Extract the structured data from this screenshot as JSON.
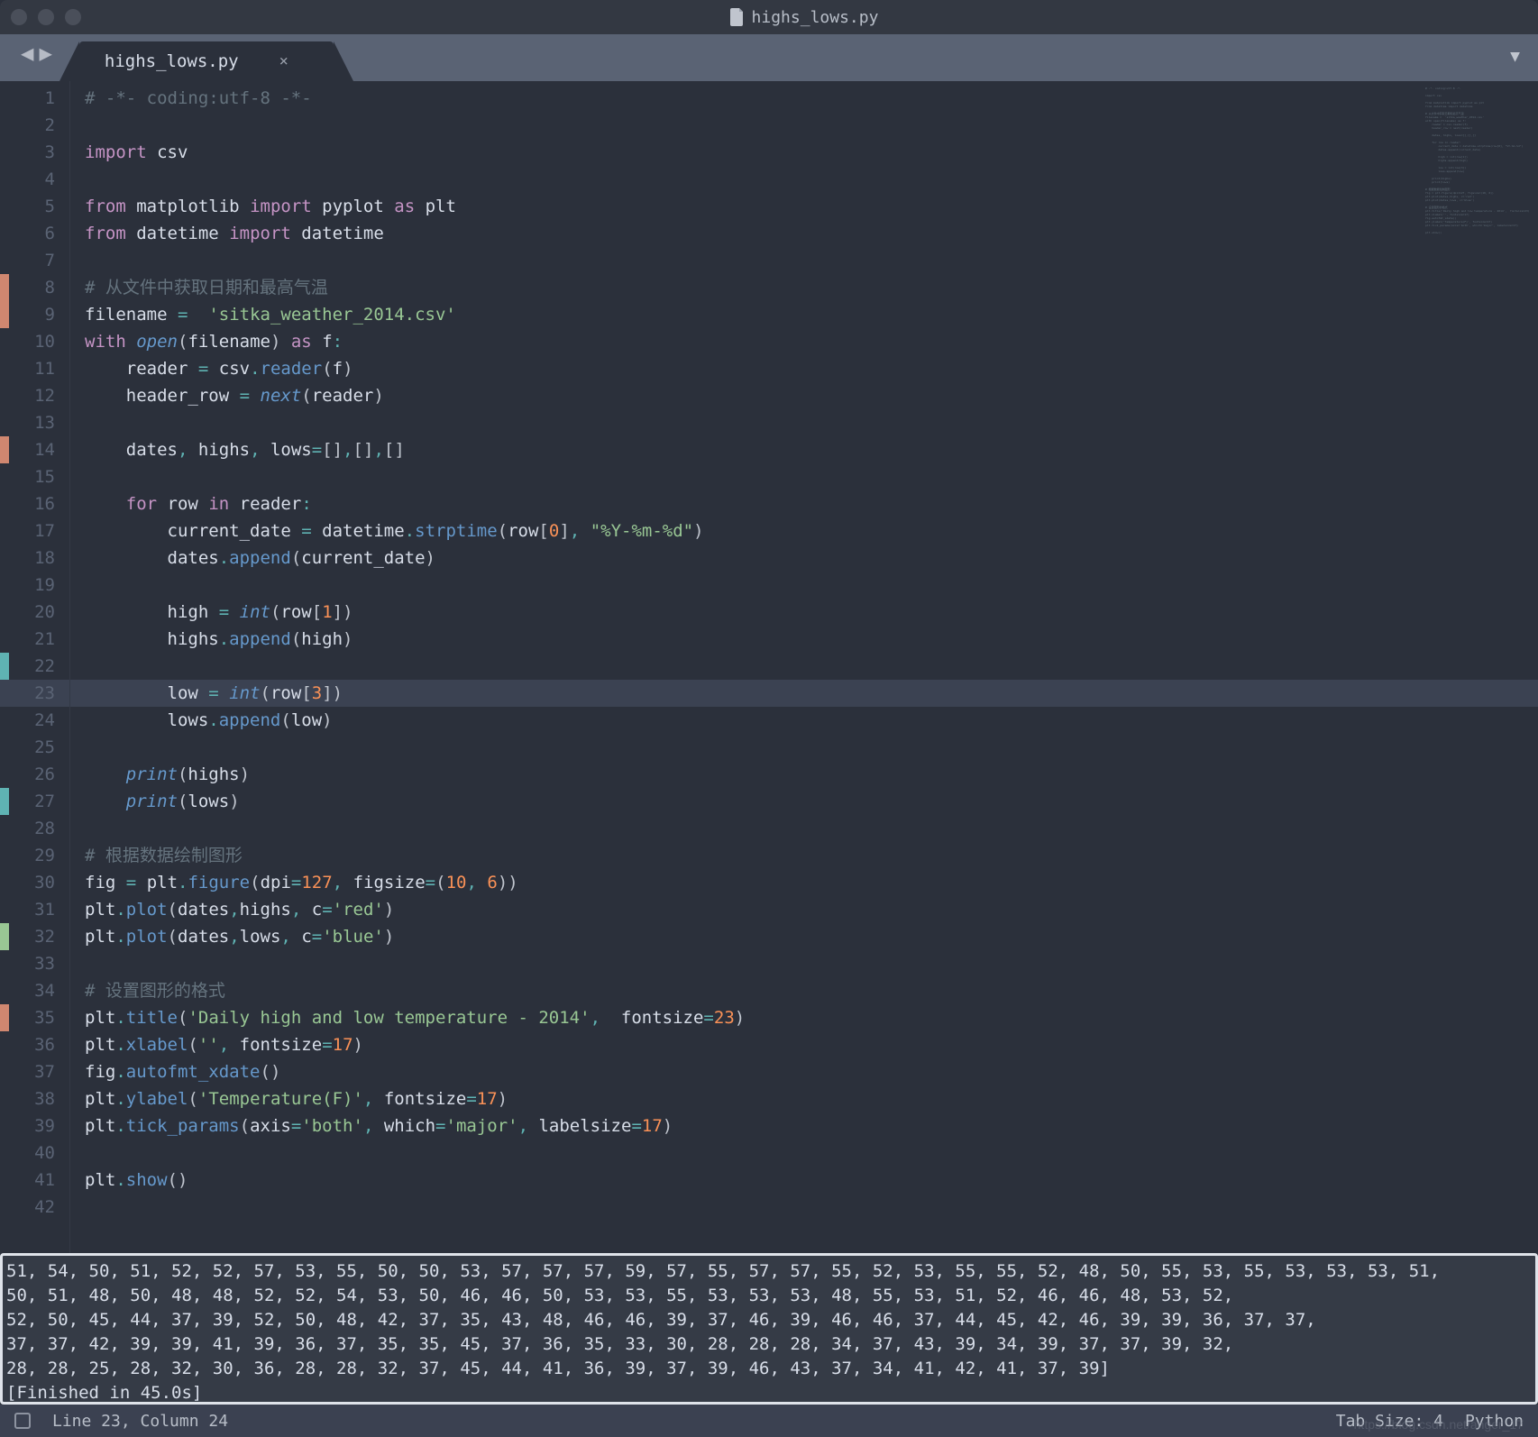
{
  "window": {
    "title": "highs_lows.py"
  },
  "tabs": [
    {
      "label": "highs_lows.py",
      "close": "×"
    }
  ],
  "nav": {
    "back": "◀",
    "forward": "▶",
    "dropdown": "▼"
  },
  "gutter_markers": {
    "orange": [
      8,
      9,
      14,
      35
    ],
    "teal": [
      22,
      27
    ],
    "green": [
      32
    ]
  },
  "highlighted_line": 23,
  "code_lines": [
    {
      "n": 1,
      "seg": [
        {
          "c": "cmt",
          "t": "# -*- coding:utf-8 -*-"
        }
      ]
    },
    {
      "n": 2,
      "seg": []
    },
    {
      "n": 3,
      "seg": [
        {
          "c": "kw",
          "t": "import"
        },
        {
          "c": "pn",
          "t": " "
        },
        {
          "c": "nm",
          "t": "csv"
        }
      ]
    },
    {
      "n": 4,
      "seg": []
    },
    {
      "n": 5,
      "seg": [
        {
          "c": "kw",
          "t": "from"
        },
        {
          "c": "pn",
          "t": " "
        },
        {
          "c": "nm",
          "t": "matplotlib"
        },
        {
          "c": "pn",
          "t": " "
        },
        {
          "c": "kw",
          "t": "import"
        },
        {
          "c": "pn",
          "t": " "
        },
        {
          "c": "nm",
          "t": "pyplot"
        },
        {
          "c": "pn",
          "t": " "
        },
        {
          "c": "kw",
          "t": "as"
        },
        {
          "c": "pn",
          "t": " "
        },
        {
          "c": "nm",
          "t": "plt"
        }
      ]
    },
    {
      "n": 6,
      "seg": [
        {
          "c": "kw",
          "t": "from"
        },
        {
          "c": "pn",
          "t": " "
        },
        {
          "c": "nm",
          "t": "datetime"
        },
        {
          "c": "pn",
          "t": " "
        },
        {
          "c": "kw",
          "t": "import"
        },
        {
          "c": "pn",
          "t": " "
        },
        {
          "c": "nm",
          "t": "datetime"
        }
      ]
    },
    {
      "n": 7,
      "seg": []
    },
    {
      "n": 8,
      "seg": [
        {
          "c": "cmt",
          "t": "# 从文件中获取日期和最高气温"
        }
      ]
    },
    {
      "n": 9,
      "seg": [
        {
          "c": "nm",
          "t": "filename"
        },
        {
          "c": "pn",
          "t": " "
        },
        {
          "c": "op",
          "t": "="
        },
        {
          "c": "pn",
          "t": "  "
        },
        {
          "c": "str",
          "t": "'sitka_weather_2014.csv'"
        }
      ]
    },
    {
      "n": 10,
      "seg": [
        {
          "c": "kw",
          "t": "with"
        },
        {
          "c": "pn",
          "t": " "
        },
        {
          "c": "fn-i",
          "t": "open"
        },
        {
          "c": "pn",
          "t": "("
        },
        {
          "c": "nm",
          "t": "filename"
        },
        {
          "c": "pn",
          "t": ") "
        },
        {
          "c": "kw",
          "t": "as"
        },
        {
          "c": "pn",
          "t": " "
        },
        {
          "c": "nm",
          "t": "f"
        },
        {
          "c": "op",
          "t": ":"
        }
      ]
    },
    {
      "n": 11,
      "seg": [
        {
          "c": "pn",
          "t": "    "
        },
        {
          "c": "nm",
          "t": "reader"
        },
        {
          "c": "pn",
          "t": " "
        },
        {
          "c": "op",
          "t": "="
        },
        {
          "c": "pn",
          "t": " "
        },
        {
          "c": "nm",
          "t": "csv"
        },
        {
          "c": "op",
          "t": "."
        },
        {
          "c": "fn",
          "t": "reader"
        },
        {
          "c": "pn",
          "t": "("
        },
        {
          "c": "nm",
          "t": "f"
        },
        {
          "c": "pn",
          "t": ")"
        }
      ]
    },
    {
      "n": 12,
      "seg": [
        {
          "c": "pn",
          "t": "    "
        },
        {
          "c": "nm",
          "t": "header_row"
        },
        {
          "c": "pn",
          "t": " "
        },
        {
          "c": "op",
          "t": "="
        },
        {
          "c": "pn",
          "t": " "
        },
        {
          "c": "fn-i",
          "t": "next"
        },
        {
          "c": "pn",
          "t": "("
        },
        {
          "c": "nm",
          "t": "reader"
        },
        {
          "c": "pn",
          "t": ")"
        }
      ]
    },
    {
      "n": 13,
      "seg": []
    },
    {
      "n": 14,
      "seg": [
        {
          "c": "pn",
          "t": "    "
        },
        {
          "c": "nm",
          "t": "dates"
        },
        {
          "c": "op",
          "t": ","
        },
        {
          "c": "pn",
          "t": " "
        },
        {
          "c": "nm",
          "t": "highs"
        },
        {
          "c": "op",
          "t": ","
        },
        {
          "c": "pn",
          "t": " "
        },
        {
          "c": "nm",
          "t": "lows"
        },
        {
          "c": "op",
          "t": "="
        },
        {
          "c": "pn",
          "t": "[]"
        },
        {
          "c": "op",
          "t": ","
        },
        {
          "c": "pn",
          "t": "[]"
        },
        {
          "c": "op",
          "t": ","
        },
        {
          "c": "pn",
          "t": "[]"
        }
      ]
    },
    {
      "n": 15,
      "seg": []
    },
    {
      "n": 16,
      "seg": [
        {
          "c": "pn",
          "t": "    "
        },
        {
          "c": "kw",
          "t": "for"
        },
        {
          "c": "pn",
          "t": " "
        },
        {
          "c": "nm",
          "t": "row"
        },
        {
          "c": "pn",
          "t": " "
        },
        {
          "c": "kw",
          "t": "in"
        },
        {
          "c": "pn",
          "t": " "
        },
        {
          "c": "nm",
          "t": "reader"
        },
        {
          "c": "op",
          "t": ":"
        }
      ]
    },
    {
      "n": 17,
      "seg": [
        {
          "c": "pn",
          "t": "        "
        },
        {
          "c": "nm",
          "t": "current_date"
        },
        {
          "c": "pn",
          "t": " "
        },
        {
          "c": "op",
          "t": "="
        },
        {
          "c": "pn",
          "t": " "
        },
        {
          "c": "nm",
          "t": "datetime"
        },
        {
          "c": "op",
          "t": "."
        },
        {
          "c": "fn",
          "t": "strptime"
        },
        {
          "c": "pn",
          "t": "("
        },
        {
          "c": "nm",
          "t": "row"
        },
        {
          "c": "pn",
          "t": "["
        },
        {
          "c": "num",
          "t": "0"
        },
        {
          "c": "pn",
          "t": "]"
        },
        {
          "c": "op",
          "t": ","
        },
        {
          "c": "pn",
          "t": " "
        },
        {
          "c": "str",
          "t": "\"%Y-%m-%d\""
        },
        {
          "c": "pn",
          "t": ")"
        }
      ]
    },
    {
      "n": 18,
      "seg": [
        {
          "c": "pn",
          "t": "        "
        },
        {
          "c": "nm",
          "t": "dates"
        },
        {
          "c": "op",
          "t": "."
        },
        {
          "c": "fn",
          "t": "append"
        },
        {
          "c": "pn",
          "t": "("
        },
        {
          "c": "nm",
          "t": "current_date"
        },
        {
          "c": "pn",
          "t": ")"
        }
      ]
    },
    {
      "n": 19,
      "seg": []
    },
    {
      "n": 20,
      "seg": [
        {
          "c": "pn",
          "t": "        "
        },
        {
          "c": "nm",
          "t": "high"
        },
        {
          "c": "pn",
          "t": " "
        },
        {
          "c": "op",
          "t": "="
        },
        {
          "c": "pn",
          "t": " "
        },
        {
          "c": "fn-i",
          "t": "int"
        },
        {
          "c": "pn",
          "t": "("
        },
        {
          "c": "nm",
          "t": "row"
        },
        {
          "c": "pn",
          "t": "["
        },
        {
          "c": "num",
          "t": "1"
        },
        {
          "c": "pn",
          "t": "])"
        }
      ]
    },
    {
      "n": 21,
      "seg": [
        {
          "c": "pn",
          "t": "        "
        },
        {
          "c": "nm",
          "t": "highs"
        },
        {
          "c": "op",
          "t": "."
        },
        {
          "c": "fn",
          "t": "append"
        },
        {
          "c": "pn",
          "t": "("
        },
        {
          "c": "nm",
          "t": "high"
        },
        {
          "c": "pn",
          "t": ")"
        }
      ]
    },
    {
      "n": 22,
      "seg": []
    },
    {
      "n": 23,
      "seg": [
        {
          "c": "pn",
          "t": "        "
        },
        {
          "c": "nm",
          "t": "low"
        },
        {
          "c": "pn",
          "t": " "
        },
        {
          "c": "op",
          "t": "="
        },
        {
          "c": "pn",
          "t": " "
        },
        {
          "c": "fn-i",
          "t": "int"
        },
        {
          "c": "pn",
          "t": "("
        },
        {
          "c": "nm",
          "t": "row"
        },
        {
          "c": "pn",
          "t": "["
        },
        {
          "c": "num",
          "t": "3"
        },
        {
          "c": "pn",
          "t": "])"
        }
      ]
    },
    {
      "n": 24,
      "seg": [
        {
          "c": "pn",
          "t": "        "
        },
        {
          "c": "nm",
          "t": "lows"
        },
        {
          "c": "op",
          "t": "."
        },
        {
          "c": "fn",
          "t": "append"
        },
        {
          "c": "pn",
          "t": "("
        },
        {
          "c": "nm",
          "t": "low"
        },
        {
          "c": "pn",
          "t": ")"
        }
      ]
    },
    {
      "n": 25,
      "seg": []
    },
    {
      "n": 26,
      "seg": [
        {
          "c": "pn",
          "t": "    "
        },
        {
          "c": "fn-i",
          "t": "print"
        },
        {
          "c": "pn",
          "t": "("
        },
        {
          "c": "nm",
          "t": "highs"
        },
        {
          "c": "pn",
          "t": ")"
        }
      ]
    },
    {
      "n": 27,
      "seg": [
        {
          "c": "pn",
          "t": "    "
        },
        {
          "c": "fn-i",
          "t": "print"
        },
        {
          "c": "pn",
          "t": "("
        },
        {
          "c": "nm",
          "t": "lows"
        },
        {
          "c": "pn",
          "t": ")"
        }
      ]
    },
    {
      "n": 28,
      "seg": []
    },
    {
      "n": 29,
      "seg": [
        {
          "c": "cmt",
          "t": "# 根据数据绘制图形"
        }
      ]
    },
    {
      "n": 30,
      "seg": [
        {
          "c": "nm",
          "t": "fig"
        },
        {
          "c": "pn",
          "t": " "
        },
        {
          "c": "op",
          "t": "="
        },
        {
          "c": "pn",
          "t": " "
        },
        {
          "c": "nm",
          "t": "plt"
        },
        {
          "c": "op",
          "t": "."
        },
        {
          "c": "fn",
          "t": "figure"
        },
        {
          "c": "pn",
          "t": "("
        },
        {
          "c": "nm",
          "t": "dpi"
        },
        {
          "c": "op",
          "t": "="
        },
        {
          "c": "num",
          "t": "127"
        },
        {
          "c": "op",
          "t": ","
        },
        {
          "c": "pn",
          "t": " "
        },
        {
          "c": "nm",
          "t": "figsize"
        },
        {
          "c": "op",
          "t": "="
        },
        {
          "c": "pn",
          "t": "("
        },
        {
          "c": "num",
          "t": "10"
        },
        {
          "c": "op",
          "t": ","
        },
        {
          "c": "pn",
          "t": " "
        },
        {
          "c": "num",
          "t": "6"
        },
        {
          "c": "pn",
          "t": "))"
        }
      ]
    },
    {
      "n": 31,
      "seg": [
        {
          "c": "nm",
          "t": "plt"
        },
        {
          "c": "op",
          "t": "."
        },
        {
          "c": "fn",
          "t": "plot"
        },
        {
          "c": "pn",
          "t": "("
        },
        {
          "c": "nm",
          "t": "dates"
        },
        {
          "c": "op",
          "t": ","
        },
        {
          "c": "nm",
          "t": "highs"
        },
        {
          "c": "op",
          "t": ","
        },
        {
          "c": "pn",
          "t": " "
        },
        {
          "c": "nm",
          "t": "c"
        },
        {
          "c": "op",
          "t": "="
        },
        {
          "c": "str",
          "t": "'red'"
        },
        {
          "c": "pn",
          "t": ")"
        }
      ]
    },
    {
      "n": 32,
      "seg": [
        {
          "c": "nm",
          "t": "plt"
        },
        {
          "c": "op",
          "t": "."
        },
        {
          "c": "fn",
          "t": "plot"
        },
        {
          "c": "pn",
          "t": "("
        },
        {
          "c": "nm",
          "t": "dates"
        },
        {
          "c": "op",
          "t": ","
        },
        {
          "c": "nm",
          "t": "lows"
        },
        {
          "c": "op",
          "t": ","
        },
        {
          "c": "pn",
          "t": " "
        },
        {
          "c": "nm",
          "t": "c"
        },
        {
          "c": "op",
          "t": "="
        },
        {
          "c": "str",
          "t": "'blue'"
        },
        {
          "c": "pn",
          "t": ")"
        }
      ]
    },
    {
      "n": 33,
      "seg": []
    },
    {
      "n": 34,
      "seg": [
        {
          "c": "cmt",
          "t": "# 设置图形的格式"
        }
      ]
    },
    {
      "n": 35,
      "seg": [
        {
          "c": "nm",
          "t": "plt"
        },
        {
          "c": "op",
          "t": "."
        },
        {
          "c": "fn",
          "t": "title"
        },
        {
          "c": "pn",
          "t": "("
        },
        {
          "c": "str",
          "t": "'Daily high and low temperature - 2014'"
        },
        {
          "c": "op",
          "t": ","
        },
        {
          "c": "pn",
          "t": "  "
        },
        {
          "c": "nm",
          "t": "fontsize"
        },
        {
          "c": "op",
          "t": "="
        },
        {
          "c": "num",
          "t": "23"
        },
        {
          "c": "pn",
          "t": ")"
        }
      ]
    },
    {
      "n": 36,
      "seg": [
        {
          "c": "nm",
          "t": "plt"
        },
        {
          "c": "op",
          "t": "."
        },
        {
          "c": "fn",
          "t": "xlabel"
        },
        {
          "c": "pn",
          "t": "("
        },
        {
          "c": "str",
          "t": "''"
        },
        {
          "c": "op",
          "t": ","
        },
        {
          "c": "pn",
          "t": " "
        },
        {
          "c": "nm",
          "t": "fontsize"
        },
        {
          "c": "op",
          "t": "="
        },
        {
          "c": "num",
          "t": "17"
        },
        {
          "c": "pn",
          "t": ")"
        }
      ]
    },
    {
      "n": 37,
      "seg": [
        {
          "c": "nm",
          "t": "fig"
        },
        {
          "c": "op",
          "t": "."
        },
        {
          "c": "fn",
          "t": "autofmt_xdate"
        },
        {
          "c": "pn",
          "t": "()"
        }
      ]
    },
    {
      "n": 38,
      "seg": [
        {
          "c": "nm",
          "t": "plt"
        },
        {
          "c": "op",
          "t": "."
        },
        {
          "c": "fn",
          "t": "ylabel"
        },
        {
          "c": "pn",
          "t": "("
        },
        {
          "c": "str",
          "t": "'Temperature(F)'"
        },
        {
          "c": "op",
          "t": ","
        },
        {
          "c": "pn",
          "t": " "
        },
        {
          "c": "nm",
          "t": "fontsize"
        },
        {
          "c": "op",
          "t": "="
        },
        {
          "c": "num",
          "t": "17"
        },
        {
          "c": "pn",
          "t": ")"
        }
      ]
    },
    {
      "n": 39,
      "seg": [
        {
          "c": "nm",
          "t": "plt"
        },
        {
          "c": "op",
          "t": "."
        },
        {
          "c": "fn",
          "t": "tick_params"
        },
        {
          "c": "pn",
          "t": "("
        },
        {
          "c": "nm",
          "t": "axis"
        },
        {
          "c": "op",
          "t": "="
        },
        {
          "c": "str",
          "t": "'both'"
        },
        {
          "c": "op",
          "t": ","
        },
        {
          "c": "pn",
          "t": " "
        },
        {
          "c": "nm",
          "t": "which"
        },
        {
          "c": "op",
          "t": "="
        },
        {
          "c": "str",
          "t": "'major'"
        },
        {
          "c": "op",
          "t": ","
        },
        {
          "c": "pn",
          "t": " "
        },
        {
          "c": "nm",
          "t": "labelsize"
        },
        {
          "c": "op",
          "t": "="
        },
        {
          "c": "num",
          "t": "17"
        },
        {
          "c": "pn",
          "t": ")"
        }
      ]
    },
    {
      "n": 40,
      "seg": []
    },
    {
      "n": 41,
      "seg": [
        {
          "c": "nm",
          "t": "plt"
        },
        {
          "c": "op",
          "t": "."
        },
        {
          "c": "fn",
          "t": "show"
        },
        {
          "c": "pn",
          "t": "()"
        }
      ]
    },
    {
      "n": 42,
      "seg": []
    }
  ],
  "console_lines": [
    "51, 54, 50, 51, 52, 52, 57, 53, 55, 50, 50, 53, 57, 57, 57, 59, 57, 55, 57, 57, 55, 52, 53, 55, 55, 52, 48, 50, 55, 53, 55, 53, 53, 53, 51,",
    "50, 51, 48, 50, 48, 48, 52, 52, 54, 53, 50, 46, 46, 50, 53, 53, 55, 53, 53, 53, 48, 55, 53, 51, 52, 46, 46, 48, 53, 52,",
    "52, 50, 45, 44, 37, 39, 52, 50, 48, 42, 37, 35, 43, 48, 46, 46, 39, 37, 46, 39, 46, 46, 37, 44, 45, 42, 46, 39, 39, 36, 37, 37,",
    "37, 37, 42, 39, 39, 41, 39, 36, 37, 35, 35, 45, 37, 36, 35, 33, 30, 28, 28, 28, 34, 37, 43, 39, 34, 39, 37, 37, 39, 32,",
    "28, 28, 25, 28, 32, 30, 36, 28, 28, 32, 37, 45, 44, 41, 36, 39, 37, 39, 46, 43, 37, 34, 41, 42, 41, 37, 39]",
    "[Finished in 45.0s]"
  ],
  "status": {
    "position": "Line 23, Column 24",
    "tab_size": "Tab Size: 4",
    "syntax": "Python"
  },
  "watermark": "https://blog.csdn.net/anger_17"
}
